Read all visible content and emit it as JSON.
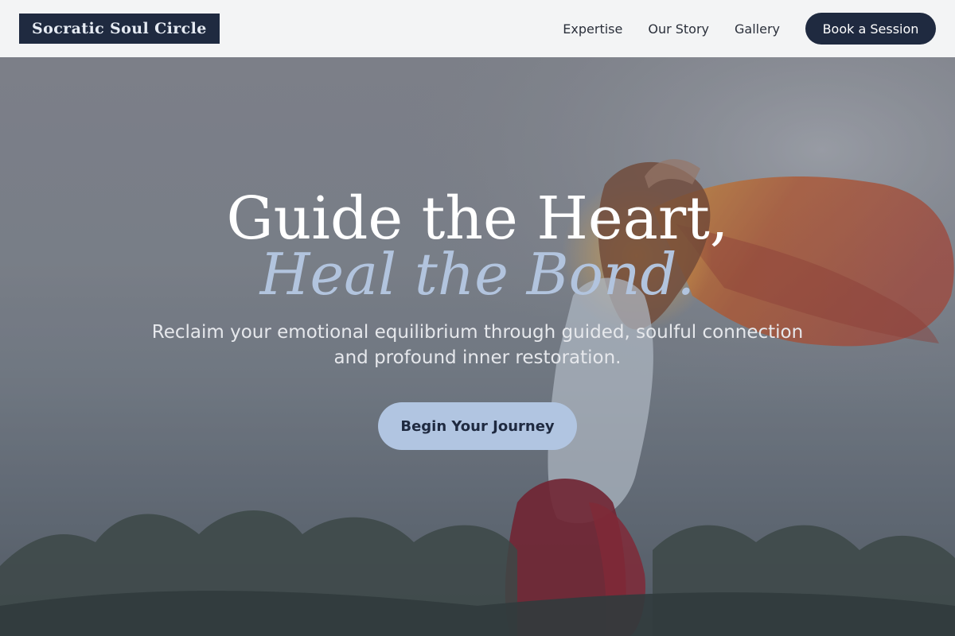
{
  "brand": {
    "name": "Socratic Soul Circle"
  },
  "nav": {
    "links": [
      {
        "label": "Expertise"
      },
      {
        "label": "Our Story"
      },
      {
        "label": "Gallery"
      }
    ],
    "cta_label": "Book a Session"
  },
  "hero": {
    "headline_line1": "Guide the Heart,",
    "headline_line2": "Heal the Bond.",
    "subtitle": "Reclaim your emotional equilibrium through guided, soulful connection and profound inner restoration.",
    "cta_label": "Begin Your Journey",
    "background_image": "woman-with-flowing-scarf-in-misty-field"
  },
  "colors": {
    "navy": "#1f2a40",
    "accent_blue": "#b1c5e1",
    "nav_bg": "#f3f4f5",
    "text_light": "#e6e8ec"
  }
}
